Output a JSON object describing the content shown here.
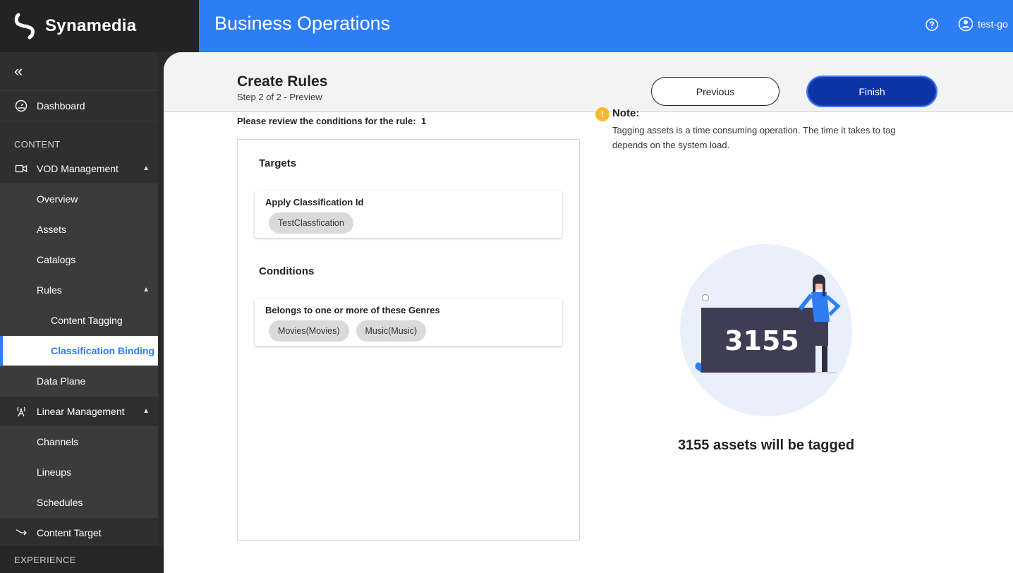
{
  "brand": {
    "name": "Synamedia"
  },
  "app": {
    "title": "Business Operations"
  },
  "user": {
    "name": "test-go"
  },
  "sidebar": {
    "collapse_glyph": "«",
    "dashboard": "Dashboard",
    "section_content": "CONTENT",
    "vod": "VOD Management",
    "overview": "Overview",
    "assets": "Assets",
    "catalogs": "Catalogs",
    "rules": "Rules",
    "content_tagging": "Content Tagging",
    "classification_binding": "Classification Binding",
    "data_plane": "Data Plane",
    "linear": "Linear Management",
    "channels": "Channels",
    "lineups": "Lineups",
    "schedules": "Schedules",
    "content_target": "Content Target",
    "section_experience": "EXPERIENCE"
  },
  "page": {
    "title": "Create Rules",
    "subtitle": "Step 2 of 2 - Preview",
    "previous_label": "Previous",
    "finish_label": "Finish"
  },
  "review": {
    "prompt": "Please review the conditions for the rule:",
    "rule_number": "1",
    "targets_heading": "Targets",
    "target_card_title": "Apply Classification Id",
    "target_chips": [
      "TestClassfication"
    ],
    "conditions_heading": "Conditions",
    "condition_card_title": "Belongs to one or more of these Genres",
    "condition_chips": [
      "Movies(Movies)",
      "Music(Music)"
    ]
  },
  "note": {
    "icon_glyph": "!",
    "title": "Note:",
    "body": "Tagging assets is a time consuming operation. The time it takes to tag depends on the system load."
  },
  "summary": {
    "board_number": "3155",
    "message": "3155 assets will be tagged"
  },
  "colors": {
    "accent": "#2d7ef5",
    "finish_button": "#0c34a6",
    "sidebar": "#2f2f2f",
    "note_icon": "#f4b92d"
  }
}
